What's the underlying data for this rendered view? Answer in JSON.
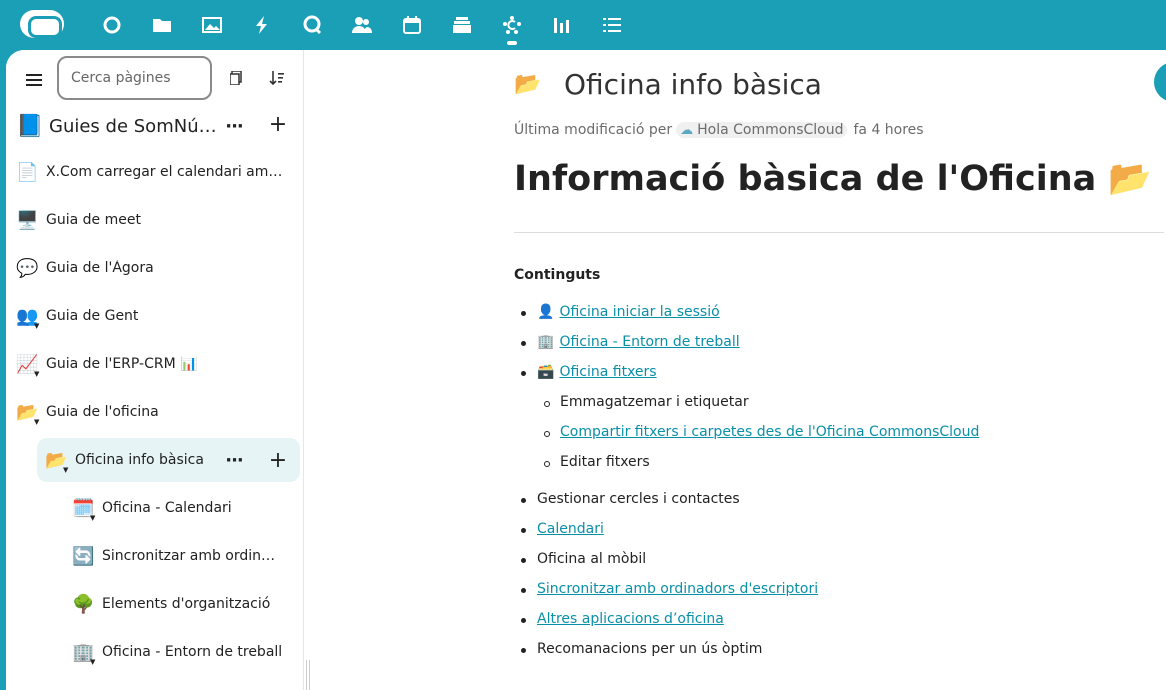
{
  "topbar": {
    "apps": [
      "dashboard-icon",
      "files-icon",
      "photos-icon",
      "activity-icon",
      "talk-icon",
      "contacts-icon",
      "calendar-icon",
      "deck-icon",
      "collectives-icon",
      "analytics-icon",
      "tasks-icon"
    ],
    "active_app": "collectives-icon",
    "accent": "#1b9fb6"
  },
  "sidebar": {
    "search_placeholder": "Cerca pàgines",
    "collective": {
      "emoji": "📘",
      "title": "Guies de SomNúvol"
    },
    "items": [
      {
        "emoji": "📄",
        "label": "X.Com carregar el calendari amb un enllaç"
      },
      {
        "emoji": "🖥️",
        "label": "Guia de meet"
      },
      {
        "emoji": "💬",
        "label": "Guia de l'Àgora"
      },
      {
        "emoji": "👥",
        "label": "Guia de Gent"
      },
      {
        "emoji": "📈",
        "label": "Guia de l'ERP-CRM 📊"
      },
      {
        "emoji": "📂",
        "label": "Guia de l'oficina"
      },
      {
        "emoji": "📂",
        "label": "Oficina info bàsica"
      },
      {
        "emoji": "🗓️",
        "label": "Oficina - Calendari"
      },
      {
        "emoji": "🔄",
        "label": "Sincronitzar amb ordinadors d'escriptori"
      },
      {
        "emoji": "🌳",
        "label": "Elements d'organització"
      },
      {
        "emoji": "🏢",
        "label": "Oficina - Entorn de treball"
      }
    ]
  },
  "page": {
    "emoji": "📂",
    "title": "Oficina info bàsica",
    "modified_prefix": "Última modificació per",
    "user": "Hola CommonsCloud",
    "time": "fa 4 hores",
    "heading": "Informació bàsica de l'Oficina 📂",
    "toc_title": "Continguts",
    "toc": [
      {
        "icon": "👤",
        "text": "Oficina iniciar la sessió",
        "link": true
      },
      {
        "icon": "🏢",
        "text": "Oficina - Entorn de treball",
        "link": true
      },
      {
        "icon": "🗃️",
        "text": "Oficina fitxers",
        "link": true
      },
      {
        "icon": "",
        "text": "Emmagatzemar i etiquetar",
        "link": false,
        "sub": true
      },
      {
        "icon": "",
        "text": "Compartir fitxers i carpetes des de l'Oficina CommonsCloud",
        "link": true,
        "sub": true
      },
      {
        "icon": "",
        "text": "Editar fitxers",
        "link": false,
        "sub": true
      },
      {
        "icon": "",
        "text": "Gestionar cercles i contactes",
        "link": false
      },
      {
        "icon": "",
        "text": "Calendari",
        "link": true
      },
      {
        "icon": "",
        "text": "Oficina al mòbil",
        "link": false
      },
      {
        "icon": "",
        "text": "Sincronitzar amb ordinadors d'escriptori",
        "link": true
      },
      {
        "icon": "",
        "text": "Altres aplicacions d’oficina ",
        "link": true
      },
      {
        "icon": "",
        "text": "Recomanacions per un ús òptim",
        "link": false
      }
    ]
  }
}
